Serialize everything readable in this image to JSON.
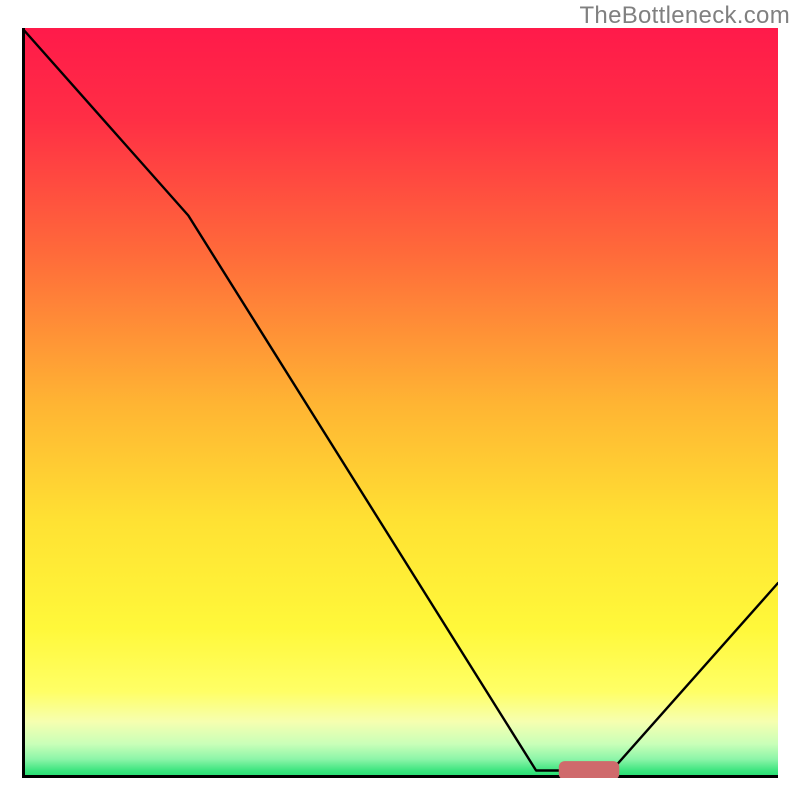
{
  "watermark": "TheBottleneck.com",
  "chart_data": {
    "type": "line",
    "title": "",
    "xlabel": "",
    "ylabel": "",
    "xlim": [
      0,
      100
    ],
    "ylim": [
      0,
      100
    ],
    "series": [
      {
        "name": "curve",
        "x": [
          0,
          22,
          68,
          73,
          78,
          100
        ],
        "y": [
          100,
          75,
          1,
          1,
          1,
          26
        ]
      }
    ],
    "marker": {
      "x_center": 75,
      "y": 1,
      "width": 8,
      "height": 2.5,
      "color": "#cf6a6c"
    },
    "background_gradient": {
      "stops": [
        {
          "offset": 0.0,
          "color": "#ff1a4a"
        },
        {
          "offset": 0.12,
          "color": "#ff2e45"
        },
        {
          "offset": 0.3,
          "color": "#ff6a3a"
        },
        {
          "offset": 0.5,
          "color": "#ffb433"
        },
        {
          "offset": 0.66,
          "color": "#ffe233"
        },
        {
          "offset": 0.8,
          "color": "#fff83a"
        },
        {
          "offset": 0.885,
          "color": "#ffff66"
        },
        {
          "offset": 0.925,
          "color": "#f6ffb0"
        },
        {
          "offset": 0.955,
          "color": "#c8ffb8"
        },
        {
          "offset": 0.975,
          "color": "#8cf5a8"
        },
        {
          "offset": 0.99,
          "color": "#3de57f"
        },
        {
          "offset": 1.0,
          "color": "#1edc6c"
        }
      ]
    },
    "axis_color": "#000000",
    "curve_color": "#000000",
    "curve_width": 2.4
  }
}
